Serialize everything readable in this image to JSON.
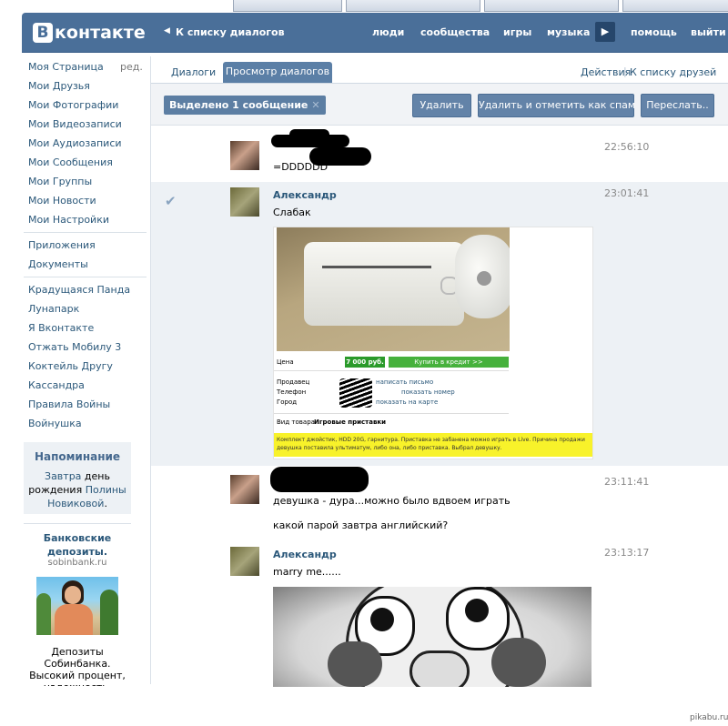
{
  "header": {
    "logo_letter": "В",
    "logo_text": "контакте",
    "back_link": "К списку диалогов",
    "nav": [
      "люди",
      "сообщества",
      "игры",
      "музыка"
    ],
    "help": "помощь",
    "logout": "выйти"
  },
  "sidebar": {
    "edit": "ред.",
    "group1": [
      "Моя Страница",
      "Мои Друзья",
      "Мои Фотографии",
      "Мои Видеозаписи",
      "Мои Аудиозаписи",
      "Мои Сообщения",
      "Мои Группы",
      "Мои Новости",
      "Мои Настройки"
    ],
    "group2": [
      "Приложения",
      "Документы"
    ],
    "group3": [
      "Крадущаяся Панда",
      "Лунапарк",
      "Я Вконтакте",
      "Отжать Мобилу 3",
      "Коктейль Другу",
      "Кассандра",
      "Правила Войны",
      "Войнушка"
    ]
  },
  "reminder": {
    "title": "Напоминание",
    "t1": "Завтра",
    "t2": " день",
    "t3": "рождения ",
    "t4": "Полины",
    "t5": "Новиковой",
    "t6": "."
  },
  "ad": {
    "title": "Банковские депозиты.",
    "domain": "sobinbank.ru",
    "text": "Депозиты Собинбанка. Высокий процент, надежность. Комиссия"
  },
  "tabs": {
    "dialogs": "Диалоги",
    "view": "Просмотр диалогов",
    "actions": "Действия",
    "friends": "К списку друзей"
  },
  "toolbar": {
    "selected": "Выделено 1 сообщение",
    "delete": "Удалить",
    "spam": "Удалить и отметить как спам",
    "forward": "Переслать.."
  },
  "messages": [
    {
      "author": "",
      "time": "22:56:10",
      "text": "=DDDDDD"
    },
    {
      "author": "Александр",
      "time": "23:01:41",
      "text": "Слабак"
    },
    {
      "author": "",
      "time": "23:11:41",
      "text": "девушка - дура...можно было вдвоем играть",
      "text2": "какой парой завтра английский?"
    },
    {
      "author": "Александр",
      "time": "23:13:17",
      "text": "marry me......"
    }
  ],
  "listing": {
    "price_label": "Цена",
    "price": "7 000 руб.",
    "credit": "Купить в кредит >>",
    "seller": "Продавец",
    "phone": "Телефон",
    "city": "Город",
    "write": "написать письмо",
    "show_number": "показать номер",
    "show_map": "показать на карте",
    "type_label": "Вид товара:",
    "type_value": "Игровые приставки",
    "description": "Комплект джойстик, HDD 20G, гарнитура. Приставка не забанена можно играть в Live. Причина продажи девушка поставила ультиматум, либо она, либо приставка. Выбрал девушку."
  },
  "watermark": "pikabu.ru",
  "colors": {
    "header": "#4a6f99",
    "link": "#2b587a",
    "button": "#6383a8",
    "highlight": "#f8f22a"
  }
}
